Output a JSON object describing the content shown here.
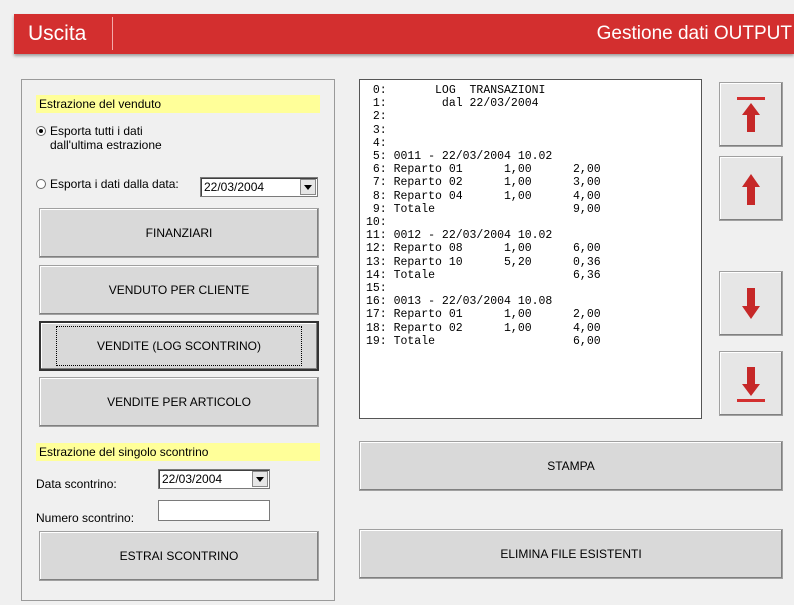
{
  "header": {
    "title": "Uscita",
    "right_title": "Gestione dati OUTPUT",
    "color": "#d32f2f"
  },
  "section1": {
    "label": "Estrazione del venduto",
    "radio_all": "Esporta tutti i dati\ndall'ultima estrazione",
    "radio_from": "Esporta i dati dalla data:",
    "radio_all_selected": true,
    "date_value": "22/03/2004"
  },
  "buttons": {
    "finanziari": "FINANZIARI",
    "venduto_cliente": "VENDUTO PER CLIENTE",
    "vendite_log": "VENDITE (LOG SCONTRINO)",
    "vendite_articolo": "VENDITE PER ARTICOLO",
    "estrai": "ESTRAI SCONTRINO",
    "stampa": "STAMPA",
    "elimina": "ELIMINA FILE ESISTENTI"
  },
  "section2": {
    "label": "Estrazione del singolo scontrino",
    "data_label": "Data scontrino:",
    "data_value": "22/03/2004",
    "numero_label": "Numero scontrino:",
    "numero_value": ""
  },
  "log": [
    " 0:       LOG  TRANSAZIONI",
    " 1:        dal 22/03/2004",
    " 2:",
    " 3:",
    " 4:",
    " 5: 0011 - 22/03/2004 10.02",
    " 6: Reparto 01      1,00      2,00",
    " 7: Reparto 02      1,00      3,00",
    " 8: Reparto 04      1,00      4,00",
    " 9: Totale                    9,00",
    "10:",
    "11: 0012 - 22/03/2004 10.02",
    "12: Reparto 08      1,00      6,00",
    "13: Reparto 10      5,20      0,36",
    "14: Totale                    6,36",
    "15:",
    "16: 0013 - 22/03/2004 10.08",
    "17: Reparto 01      1,00      2,00",
    "18: Reparto 02      1,00      4,00",
    "19: Totale                    6,00"
  ],
  "nav_icons": [
    "arrow-to-top-icon",
    "arrow-up-icon",
    "arrow-down-icon",
    "arrow-to-bottom-icon"
  ],
  "accent_arrow": "#d32f2f"
}
